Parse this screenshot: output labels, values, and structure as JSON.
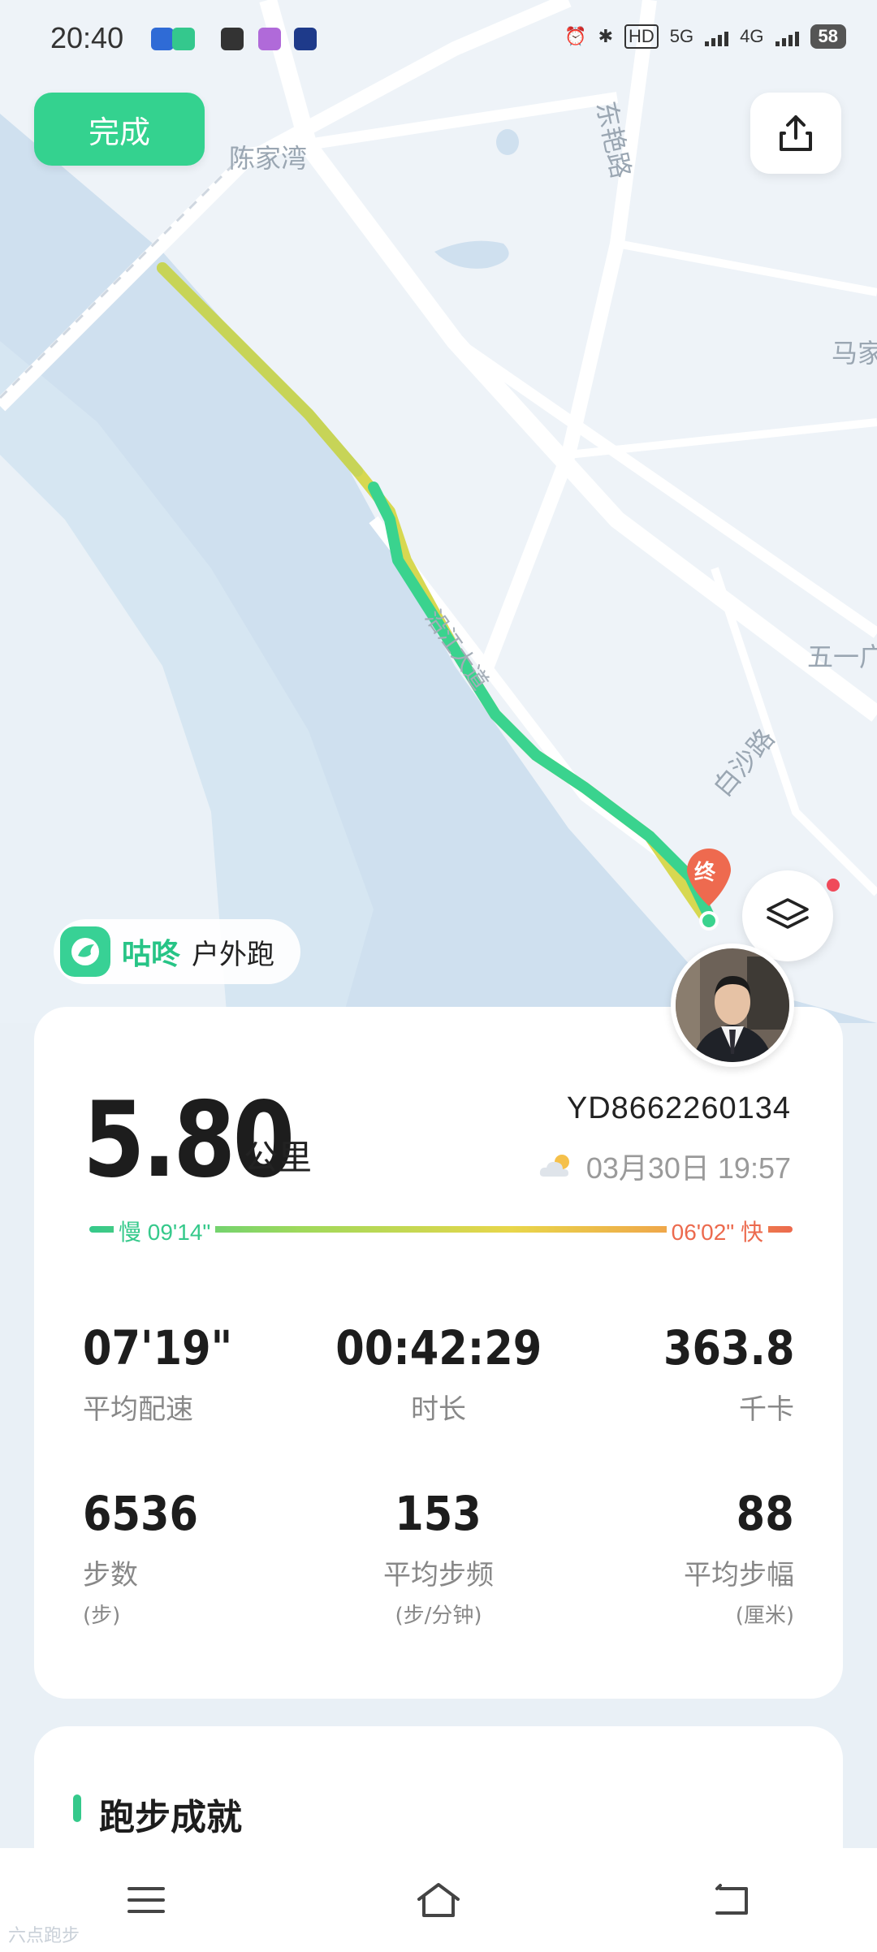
{
  "status_bar": {
    "time": "20:40",
    "network_5g": "5G",
    "network_4g": "4G",
    "hd": "HD",
    "battery": "58"
  },
  "map": {
    "labels": {
      "village": "陈家湾",
      "road_dongyan": "东艳路",
      "ma_jia": "马家",
      "wu_yi": "五一广",
      "bai_sha": "白沙路",
      "yan_jiang": "沿江大道"
    },
    "end_marker": "终"
  },
  "toolbar": {
    "done_label": "完成"
  },
  "app": {
    "name": "咕咚",
    "run_type": "户外跑"
  },
  "summary": {
    "distance": "5.80",
    "distance_unit": "公里",
    "record_id": "YD8662260134",
    "datetime": "03月30日 19:57"
  },
  "pace_scale": {
    "slow_label": "慢 09'14\"",
    "fast_label": "06'02\" 快",
    "colors": {
      "slow": "#35c98b",
      "mid": "#e8d64a",
      "fast": "#ec6a4e"
    }
  },
  "metrics": [
    {
      "value": "07'19\"",
      "label": "平均配速",
      "unit": ""
    },
    {
      "value": "00:42:29",
      "label": "时长",
      "unit": ""
    },
    {
      "value": "363.8",
      "label": "千卡",
      "unit": ""
    },
    {
      "value": "6536",
      "label": "步数",
      "unit": "(步)"
    },
    {
      "value": "153",
      "label": "平均步频",
      "unit": "(步/分钟)"
    },
    {
      "value": "88",
      "label": "平均步幅",
      "unit": "(厘米)"
    }
  ],
  "achievement": {
    "title": "跑步成就"
  },
  "watermark": "六点跑步"
}
